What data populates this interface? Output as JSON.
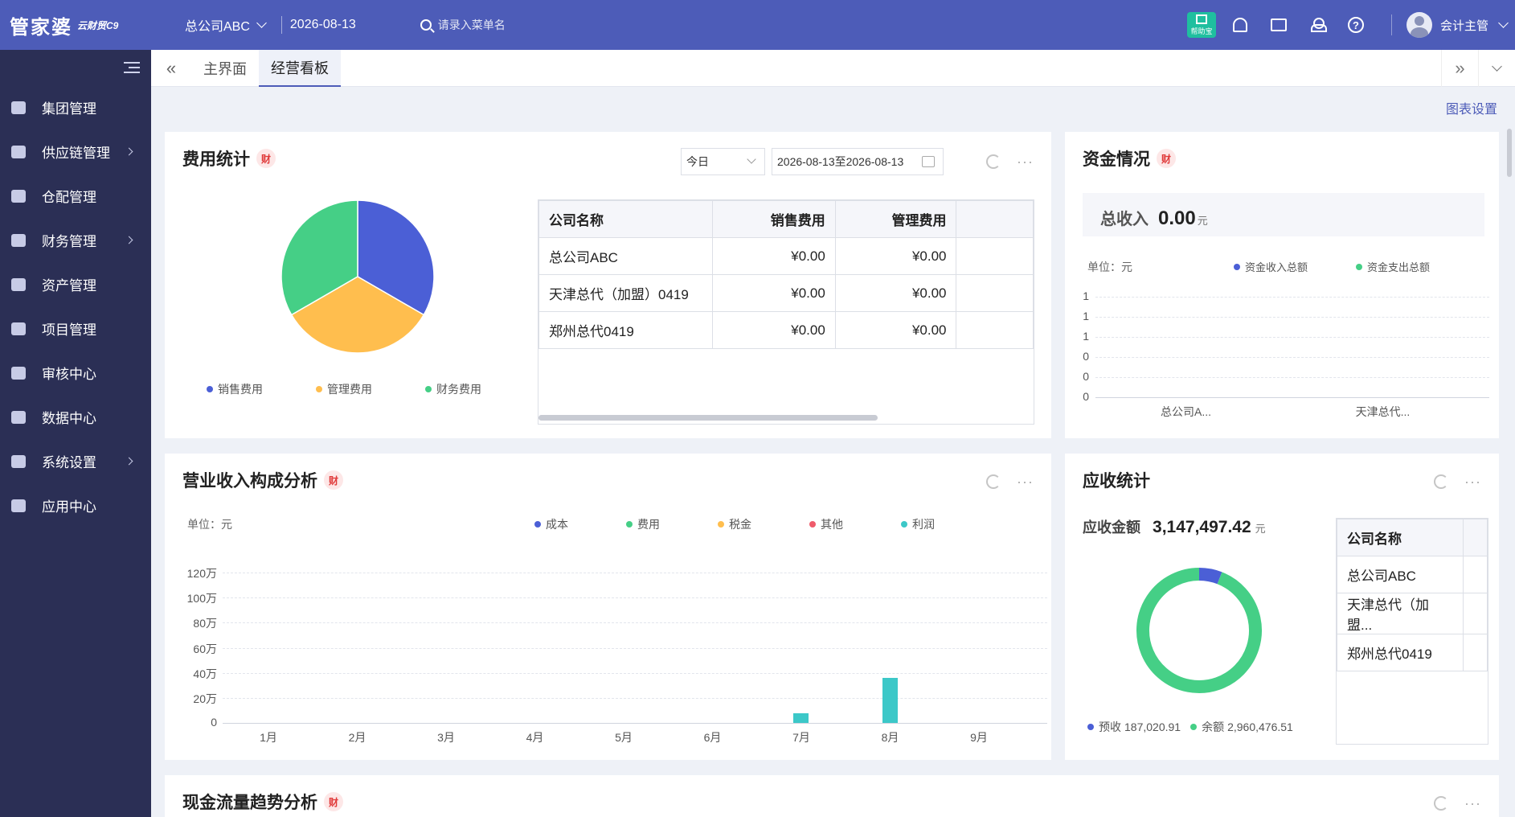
{
  "topbar": {
    "logo": "管家婆",
    "logo_sub": "云财贸C9",
    "company": "总公司ABC",
    "date": "2026-08-13",
    "search_placeholder": "请录入菜单名",
    "qr_label": "帮助宝",
    "user": "会计主管"
  },
  "sidebar": {
    "items": [
      {
        "label": "集团管理",
        "icon": "layers-icon",
        "arrow": false
      },
      {
        "label": "供应链管理",
        "icon": "supply-chain-icon",
        "arrow": true
      },
      {
        "label": "仓配管理",
        "icon": "warehouse-icon",
        "arrow": false
      },
      {
        "label": "财务管理",
        "icon": "finance-icon",
        "arrow": true
      },
      {
        "label": "资产管理",
        "icon": "wallet-icon",
        "arrow": false
      },
      {
        "label": "项目管理",
        "icon": "project-icon",
        "arrow": false
      },
      {
        "label": "审核中心",
        "icon": "audit-icon",
        "arrow": false
      },
      {
        "label": "数据中心",
        "icon": "chart-icon",
        "arrow": false
      },
      {
        "label": "系统设置",
        "icon": "settings-icon",
        "arrow": true
      },
      {
        "label": "应用中心",
        "icon": "app-icon",
        "arrow": false
      }
    ]
  },
  "tabs": {
    "items": [
      {
        "label": "主界面",
        "active": false
      },
      {
        "label": "经营看板",
        "active": true
      }
    ]
  },
  "chart_settings": "图表设置",
  "fin_badge": "财",
  "fee_card": {
    "title": "费用统计",
    "period": "今日",
    "date_range": "2026-08-13至2026-08-13",
    "legend": [
      {
        "label": "销售费用",
        "color": "#4b5fd6"
      },
      {
        "label": "管理费用",
        "color": "#ffbe4e"
      },
      {
        "label": "财务费用",
        "color": "#45cf86"
      }
    ],
    "table": {
      "headers": [
        "公司名称",
        "销售费用",
        "管理费用"
      ],
      "rows": [
        [
          "总公司ABC",
          "¥0.00",
          "¥0.00"
        ],
        [
          "天津总代（加盟）0419",
          "¥0.00",
          "¥0.00"
        ],
        [
          "郑州总代0419",
          "¥0.00",
          "¥0.00"
        ]
      ]
    }
  },
  "chart_data": [
    {
      "type": "pie",
      "title": "费用统计",
      "categories": [
        "销售费用",
        "管理费用",
        "财务费用"
      ],
      "values": [
        1,
        1,
        1
      ],
      "colors": [
        "#4b5fd6",
        "#ffbe4e",
        "#45cf86"
      ]
    },
    {
      "type": "bar",
      "title": "资金情况",
      "unit_label": "单位：元",
      "categories": [
        "总公司A...",
        "天津总代..."
      ],
      "y_ticks": [
        "0",
        "0",
        "0",
        "1",
        "1",
        "1"
      ],
      "series": [
        {
          "name": "资金收入总额",
          "color": "#4b5fd6",
          "values": [
            0,
            0
          ]
        },
        {
          "name": "资金支出总额",
          "color": "#45cf86",
          "values": [
            0,
            0
          ]
        }
      ],
      "ylim": [
        0,
        1
      ],
      "grid": true,
      "legend_position": "top-right"
    },
    {
      "type": "bar",
      "title": "营业收入构成分析",
      "unit_label": "单位：元",
      "categories": [
        "1月",
        "2月",
        "3月",
        "4月",
        "5月",
        "6月",
        "7月",
        "8月",
        "9月"
      ],
      "y_ticks": [
        "0",
        "20万",
        "40万",
        "60万",
        "80万",
        "100万",
        "120万"
      ],
      "series": [
        {
          "name": "成本",
          "color": "#4b5fd6",
          "values": [
            0,
            0,
            0,
            0,
            0,
            0,
            0,
            0,
            0
          ]
        },
        {
          "name": "费用",
          "color": "#45cf86",
          "values": [
            0,
            0,
            0,
            0,
            0,
            0,
            0,
            0,
            0
          ]
        },
        {
          "name": "税金",
          "color": "#ffbe4e",
          "values": [
            0,
            0,
            0,
            0,
            0,
            0,
            0,
            0,
            0
          ]
        },
        {
          "name": "其他",
          "color": "#ef5b6b",
          "values": [
            0,
            0,
            0,
            0,
            0,
            0,
            0,
            0,
            0
          ]
        },
        {
          "name": "利润",
          "color": "#3cc8c8",
          "values": [
            0,
            0,
            0,
            0,
            0,
            0,
            80000,
            360000,
            0
          ]
        }
      ],
      "ylim": [
        0,
        1200000
      ],
      "grid": true,
      "legend_position": "top"
    },
    {
      "type": "pie",
      "title": "应收统计",
      "donut": true,
      "categories": [
        "预收",
        "余额"
      ],
      "values": [
        187020.91,
        2960476.51
      ],
      "labels": [
        "187,020.91",
        "2,960,476.51"
      ],
      "colors": [
        "#4b5fd6",
        "#45cf86"
      ]
    }
  ],
  "funds_card": {
    "title": "资金情况",
    "total_label": "总收入",
    "total_value": "0.00",
    "total_unit": "元"
  },
  "revenue_card": {
    "title": "营业收入构成分析"
  },
  "receivable_card": {
    "title": "应收统计",
    "amount_label": "应收金额",
    "amount_value": "3,147,497.42",
    "amount_unit": "元",
    "table": {
      "headers": [
        "公司名称"
      ],
      "rows": [
        [
          "总公司ABC"
        ],
        [
          "天津总代（加盟..."
        ],
        [
          "郑州总代0419"
        ]
      ]
    }
  },
  "cashflow_card": {
    "title": "现金流量趋势分析"
  }
}
